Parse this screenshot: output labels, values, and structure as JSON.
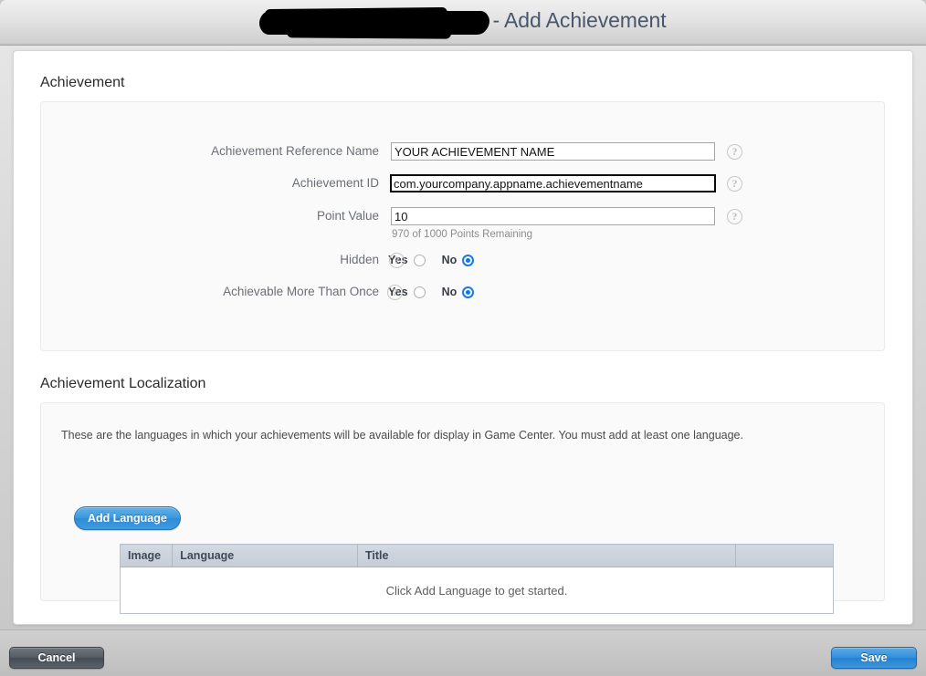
{
  "window": {
    "title_suffix": "- Add Achievement",
    "redacted_label": ""
  },
  "achievement_section": {
    "heading": "Achievement",
    "fields": [
      {
        "label": "Achievement Reference Name",
        "value": "YOUR ACHIEVEMENT NAME",
        "focused": false,
        "help": "?"
      },
      {
        "label": "Achievement ID",
        "value": "com.yourcompany.appname.achievementname",
        "focused": true,
        "help": "?"
      },
      {
        "label": "Point Value",
        "value": "10",
        "focused": false,
        "help": "?"
      }
    ],
    "points_hint": "970 of 1000 Points Remaining",
    "radios": [
      {
        "label": "Hidden",
        "options": [
          {
            "label": "Yes",
            "selected": false
          },
          {
            "label": "No",
            "selected": true
          }
        ],
        "help": "?"
      },
      {
        "label": "Achievable More Than Once",
        "options": [
          {
            "label": "Yes",
            "selected": false
          },
          {
            "label": "No",
            "selected": true
          }
        ],
        "help": "?"
      }
    ]
  },
  "localization_section": {
    "heading": "Achievement Localization",
    "description": "These are the languages in which your achievements will be available for display in Game Center. You must add at least one language.",
    "add_language_label": "Add Language",
    "table": {
      "columns": [
        "Image",
        "Language",
        "Title",
        ""
      ],
      "empty_message": "Click Add Language to get started."
    }
  },
  "footer": {
    "cancel_label": "Cancel",
    "save_label": "Save"
  },
  "colors": {
    "accent_blue": "#2f8cd4",
    "title_text": "#48576b",
    "label_gray": "#6b6f76",
    "radio_blue": "#1176e8",
    "table_header": "#c6cdd8"
  }
}
